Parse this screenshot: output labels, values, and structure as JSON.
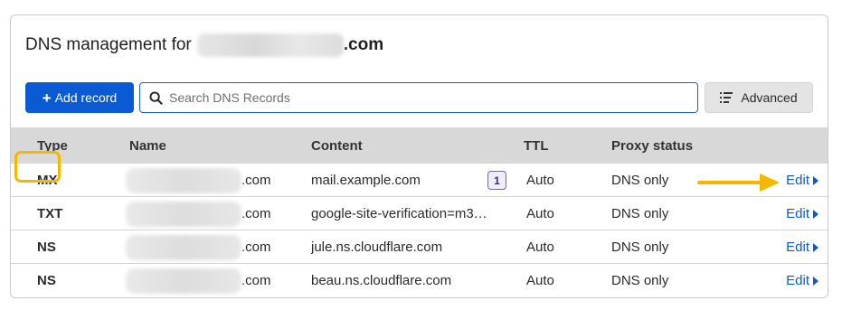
{
  "header": {
    "title_prefix": "DNS management for",
    "title_suffix": ".com"
  },
  "toolbar": {
    "add_label": "Add record",
    "add_icon": "plus-icon",
    "search_placeholder": "Search DNS Records",
    "advanced_label": "Advanced",
    "advanced_icon": "list-filter-icon"
  },
  "table": {
    "headers": {
      "type": "Type",
      "name": "Name",
      "content": "Content",
      "ttl": "TTL",
      "proxy": "Proxy status"
    },
    "rows": [
      {
        "type": "MX",
        "name_suffix": ".com",
        "content": "mail.example.com",
        "priority": "1",
        "ttl": "Auto",
        "proxy": "DNS only",
        "edit": "Edit"
      },
      {
        "type": "TXT",
        "name_suffix": ".com",
        "content": "google-site-verification=m3…",
        "ttl": "Auto",
        "proxy": "DNS only",
        "edit": "Edit"
      },
      {
        "type": "NS",
        "name_suffix": ".com",
        "content": "jule.ns.cloudflare.com",
        "ttl": "Auto",
        "proxy": "DNS only",
        "edit": "Edit"
      },
      {
        "type": "NS",
        "name_suffix": ".com",
        "content": "beau.ns.cloudflare.com",
        "ttl": "Auto",
        "proxy": "DNS only",
        "edit": "Edit"
      }
    ]
  },
  "annotations": {
    "highlight_color": "#f5b800",
    "arrow_color": "#f5b800"
  },
  "colors": {
    "primary": "#0a5bd3",
    "header_bg": "#d8d8d8"
  }
}
